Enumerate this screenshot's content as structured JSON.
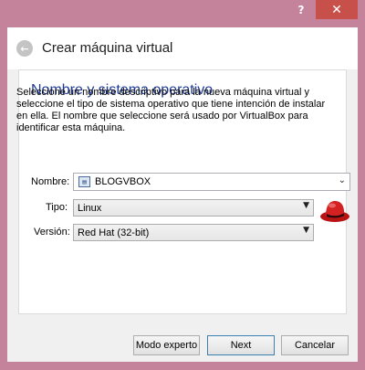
{
  "titlebar": {
    "help": "?",
    "close": "✕"
  },
  "dialog": {
    "title": "Crear máquina virtual",
    "back_glyph": "←",
    "section_title": "Nombre y sistema operativo",
    "description": "Seleccione un nombre descriptivo para la nueva máquina virtual y seleccione el tipo de sistema operativo que tiene intención de instalar en ella. El nombre que seleccione será usado por VirtualBox para identificar esta máquina."
  },
  "form": {
    "name": {
      "label": "Nombre:",
      "value": "BLOGVBOX"
    },
    "type": {
      "label": "Tipo:",
      "value": "Linux"
    },
    "version": {
      "label": "Versión:",
      "value": "Red Hat (32-bit)"
    },
    "os_icon": "red-hat-icon"
  },
  "buttons": {
    "expert": "Modo experto",
    "next": "Next",
    "cancel": "Cancelar"
  },
  "colors": {
    "frame": "#C5829B",
    "close": "#C7504A",
    "section_title": "#1F3A93",
    "panel": "#FFFFFF",
    "client": "#F0F0F0"
  }
}
